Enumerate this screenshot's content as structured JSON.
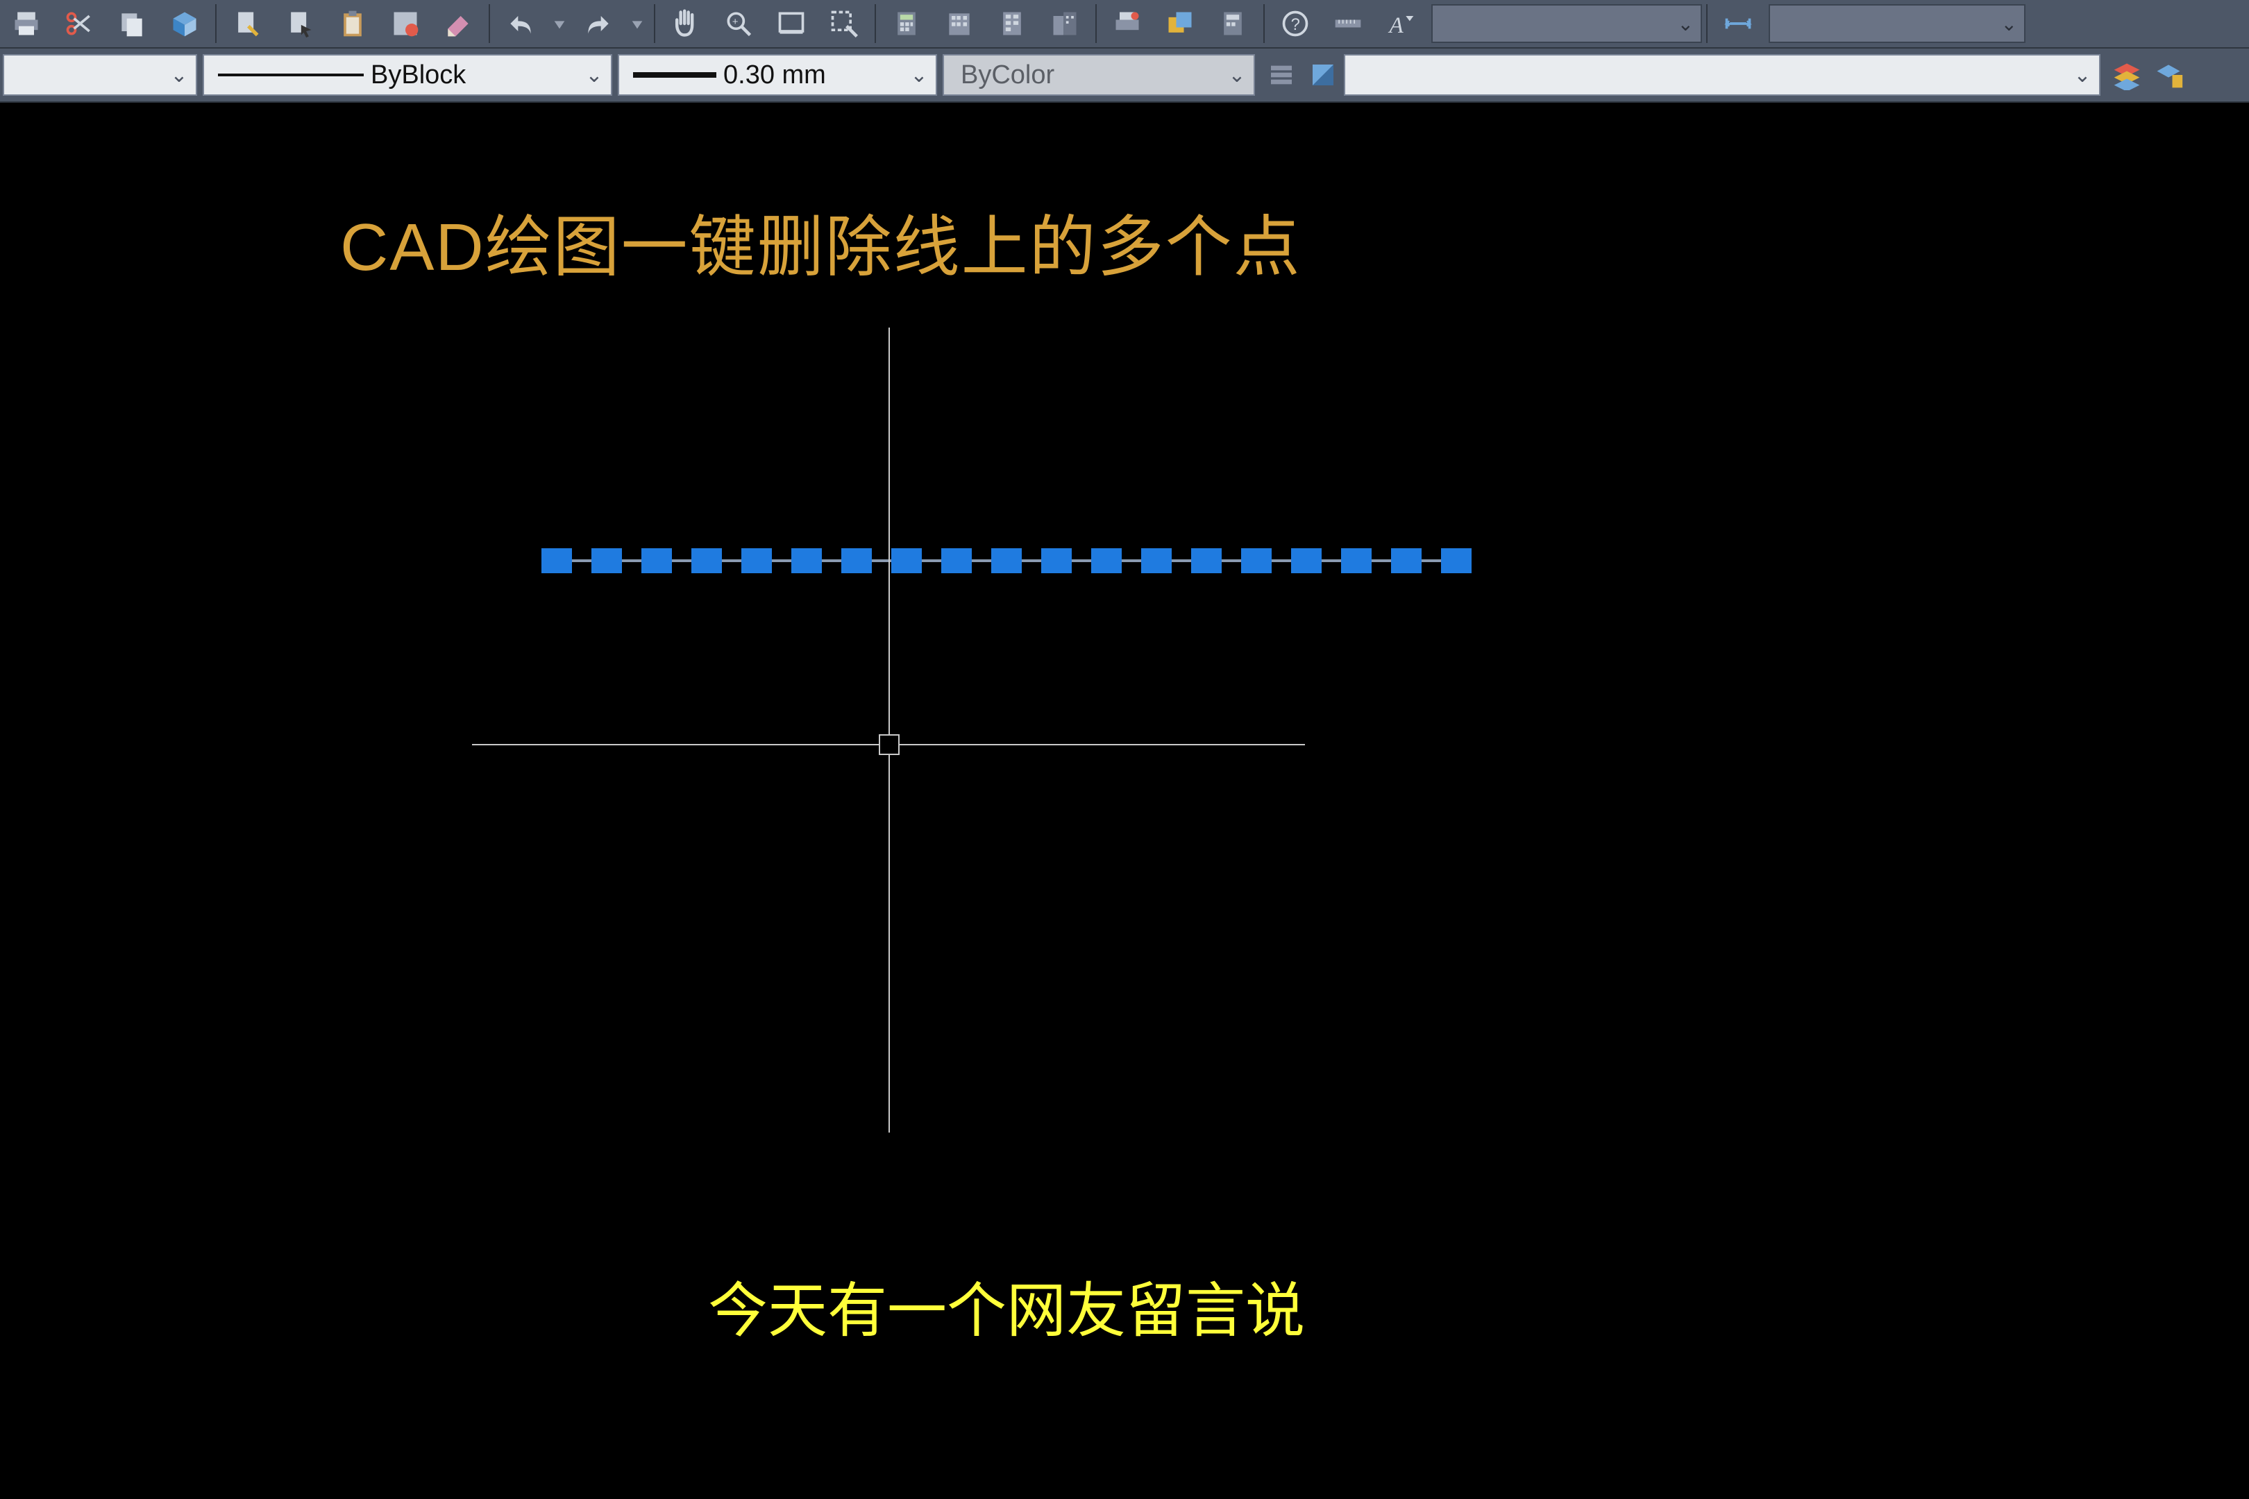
{
  "properties": {
    "color_empty": "",
    "linetype_label": "ByBlock",
    "lineweight_label": "0.30 mm",
    "plotstyle_label": "ByColor",
    "long_empty": ""
  },
  "canvas": {
    "title": "CAD绘图一键删除线上的多个点",
    "subtitle": "今天有一个网友留言说"
  },
  "grips": {
    "count": 19,
    "spacing_px": 72
  },
  "icons": {
    "row1": [
      "print-icon",
      "scissors-icon",
      "copy-icon",
      "cube-icon",
      "edit-doc-icon",
      "doc-cursor-icon",
      "clipboard-icon",
      "mark-box-icon",
      "eraser-icon",
      "undo-icon",
      "undo-dd-icon",
      "redo-icon",
      "redo-dd-icon",
      "pan-icon",
      "zoom-extents-icon",
      "zoom-window-icon",
      "zoom-select-icon",
      "calc-icon",
      "building1-icon",
      "building2-icon",
      "building3-icon",
      "print2-icon",
      "overlay-icon",
      "calc2-icon",
      "help-icon",
      "ruler-icon",
      "text-style-icon"
    ]
  }
}
